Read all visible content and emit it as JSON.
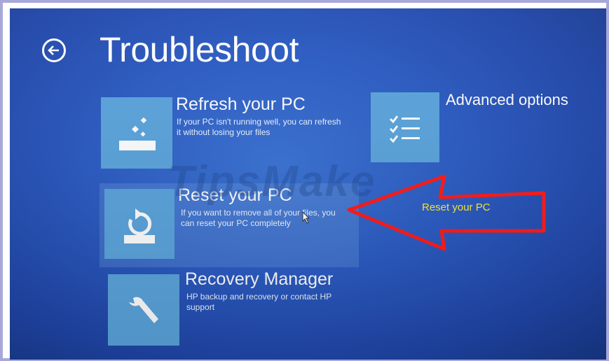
{
  "screen": {
    "title": "Troubleshoot",
    "watermark": "TipsMake"
  },
  "options": [
    {
      "title": "Refresh your PC",
      "description": "If your PC isn't running well, you can refresh it without losing your files",
      "icon": "refresh-icon"
    },
    {
      "title": "Reset your PC",
      "description": "If you want to remove all of your files, you can reset your PC completely",
      "icon": "reset-icon"
    },
    {
      "title": "Recovery Manager",
      "description": "HP backup and recovery or contact HP support",
      "icon": "wrench-icon"
    },
    {
      "title": "Advanced options",
      "description": "",
      "icon": "checklist-icon"
    }
  ],
  "annotation": {
    "label": "Reset your PC",
    "color": "#ff1a1a",
    "label_color": "#ffee33"
  },
  "colors": {
    "background": "#2a5bc4",
    "tile": "#5aa4dd"
  }
}
